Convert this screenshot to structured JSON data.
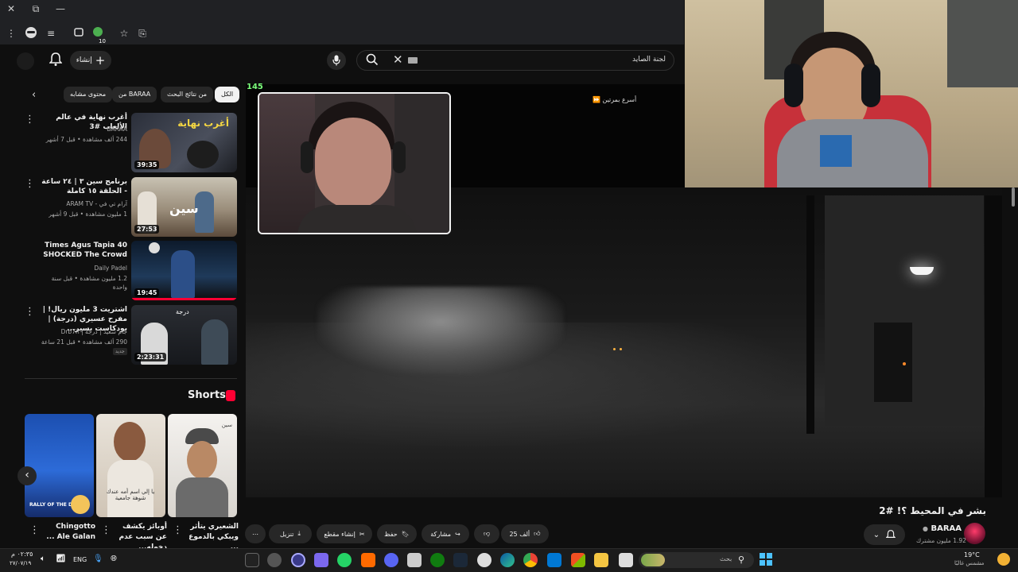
{
  "browser": {
    "window_controls": [
      "✕",
      "⧉",
      "—"
    ],
    "extension_badge": "10"
  },
  "header": {
    "create_label": "إنشاء",
    "search_query": "لجنة الصايد"
  },
  "chips": [
    {
      "label": "الكل",
      "active": true
    },
    {
      "label": "من نتائج البحث",
      "active": false
    },
    {
      "label": "من BARAA",
      "active": false
    },
    {
      "label": "محتوى مشابه",
      "active": false
    }
  ],
  "related": [
    {
      "title": "أغرب نهاية في عالم الألعاب #3",
      "channel": "BARAA",
      "meta": "244 ألف مشاهدة • قبل 7 أشهر",
      "duration": "39:35",
      "thumb_text": "أغرب نهاية"
    },
    {
      "title": "برنامج سين ٣ | ٢٤ ساعة - الحلقة ١٥ كاملة",
      "channel": "آرام تي في - ARAM TV",
      "meta": "1 مليون مشاهدة • قبل 9 أشهر",
      "duration": "27:53",
      "thumb_text": "سين"
    },
    {
      "title": "40 Times Agus Tapia SHOCKED The Crowd",
      "channel": "Daily Padel",
      "meta": "1.2 مليون مشاهدة • قبل سنة واحدة",
      "duration": "19:45",
      "thumb_text": ""
    },
    {
      "title": "اشتريت 3 مليون ريال! | مفرح عسيري (درجة) | بودكاست بسير...",
      "channel": "جام سعيد | درجة | Drb7h",
      "meta": "290 ألف مشاهدة • قبل 21 ساعة",
      "duration": "2:23:31",
      "thumb_text": "درجة",
      "extra_badge": "جديد"
    }
  ],
  "shorts": {
    "heading": "Shorts",
    "items": [
      {
        "title": "Chingotto Ale Galan ...",
        "overlay": "RALLY OF THE DAY"
      },
      {
        "title": "أوبائز يكشف عن سبب عدم دخوله...",
        "overlay": "يا إلي اسم أمه عندك شوهة جامعية"
      },
      {
        "title": "الشعيري يتأثر ويبكي بالدموع ...",
        "overlay": "سين"
      }
    ]
  },
  "player": {
    "counter": "145",
    "speed_label": "أسرع بمرتين"
  },
  "video": {
    "title": "بشر في المحيط ؟! #2",
    "channel": "BARAA",
    "subscribers": "1.92 مليون مشترك",
    "likes": "25 ألف",
    "actions": {
      "share": "مشاركة",
      "save": "حفظ",
      "clip": "إنشاء مقطع",
      "download": "تنزيل"
    }
  },
  "taskbar": {
    "weather_temp": "19°C",
    "weather_desc": "مشمس غالبًا",
    "search_placeholder": "بحث",
    "time": "٠٢:٣٥ م",
    "date": "٢٧/٠٧/١٩",
    "language": "ENG"
  },
  "colors": {
    "background": "#0f0f0f",
    "chip": "#272727",
    "accent_red": "#ff0033",
    "counter_green": "#7cff7c"
  }
}
